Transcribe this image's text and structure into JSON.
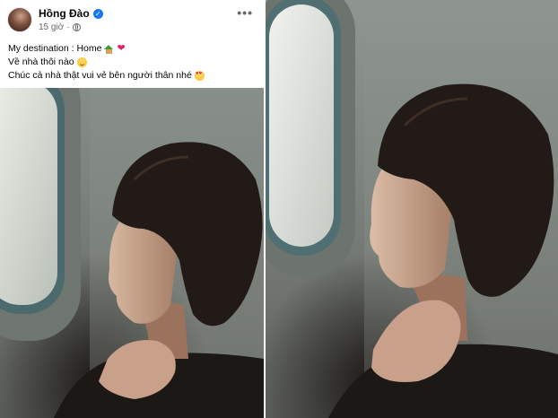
{
  "post": {
    "author": "Hồng Đào",
    "verified_badge": "✓",
    "time": "15 giờ",
    "separator": "·",
    "privacy_icon": "globe-icon",
    "more_icon": "•••",
    "lines": [
      "My destination : Home",
      "Về nhà thôi nào",
      "Chúc cả nhà thật vui vẻ bên người thân nhé"
    ],
    "line_emojis": [
      [
        "house-with-garden-emoji",
        "red-heart-emoji"
      ],
      [
        "smiling-face-emoji"
      ],
      [
        "heart-eyes-emoji"
      ]
    ]
  },
  "photos": [
    {
      "name": "photo-left",
      "subject": "woman looking out airplane window"
    },
    {
      "name": "photo-right",
      "subject": "woman looking out airplane window"
    }
  ],
  "colors": {
    "verified": "#1877f2",
    "secondary_text": "#65676b",
    "primary_text": "#050505",
    "heart": "#e0245e"
  }
}
